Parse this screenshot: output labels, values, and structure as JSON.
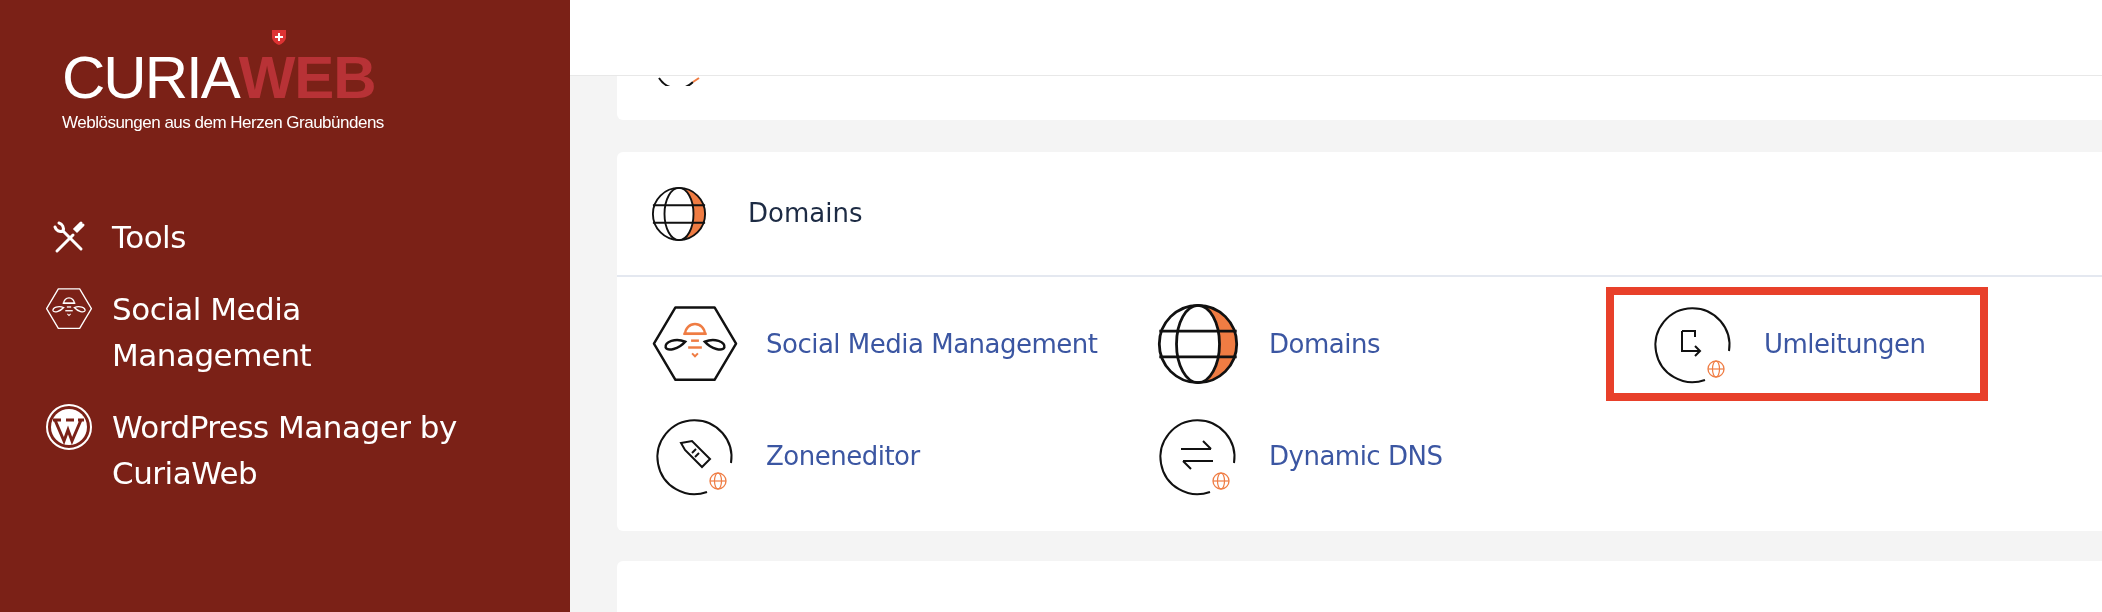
{
  "logo": {
    "brand_primary": "CURIA",
    "brand_accent": "WEB",
    "tagline": "Weblösungen aus dem Herzen Graubündens"
  },
  "sidebar": {
    "items": [
      {
        "label": "Tools"
      },
      {
        "label": "Social Media Management"
      },
      {
        "label": "WordPress Manager by CuriaWeb"
      }
    ]
  },
  "domains_card": {
    "title": "Domains",
    "items": [
      {
        "label": "Social Media Management",
        "highlighted": false
      },
      {
        "label": "Domains",
        "highlighted": false
      },
      {
        "label": "Umleitungen",
        "highlighted": true
      },
      {
        "label": "Zoneneditor",
        "highlighted": false
      },
      {
        "label": "Dynamic DNS",
        "highlighted": false
      }
    ]
  }
}
